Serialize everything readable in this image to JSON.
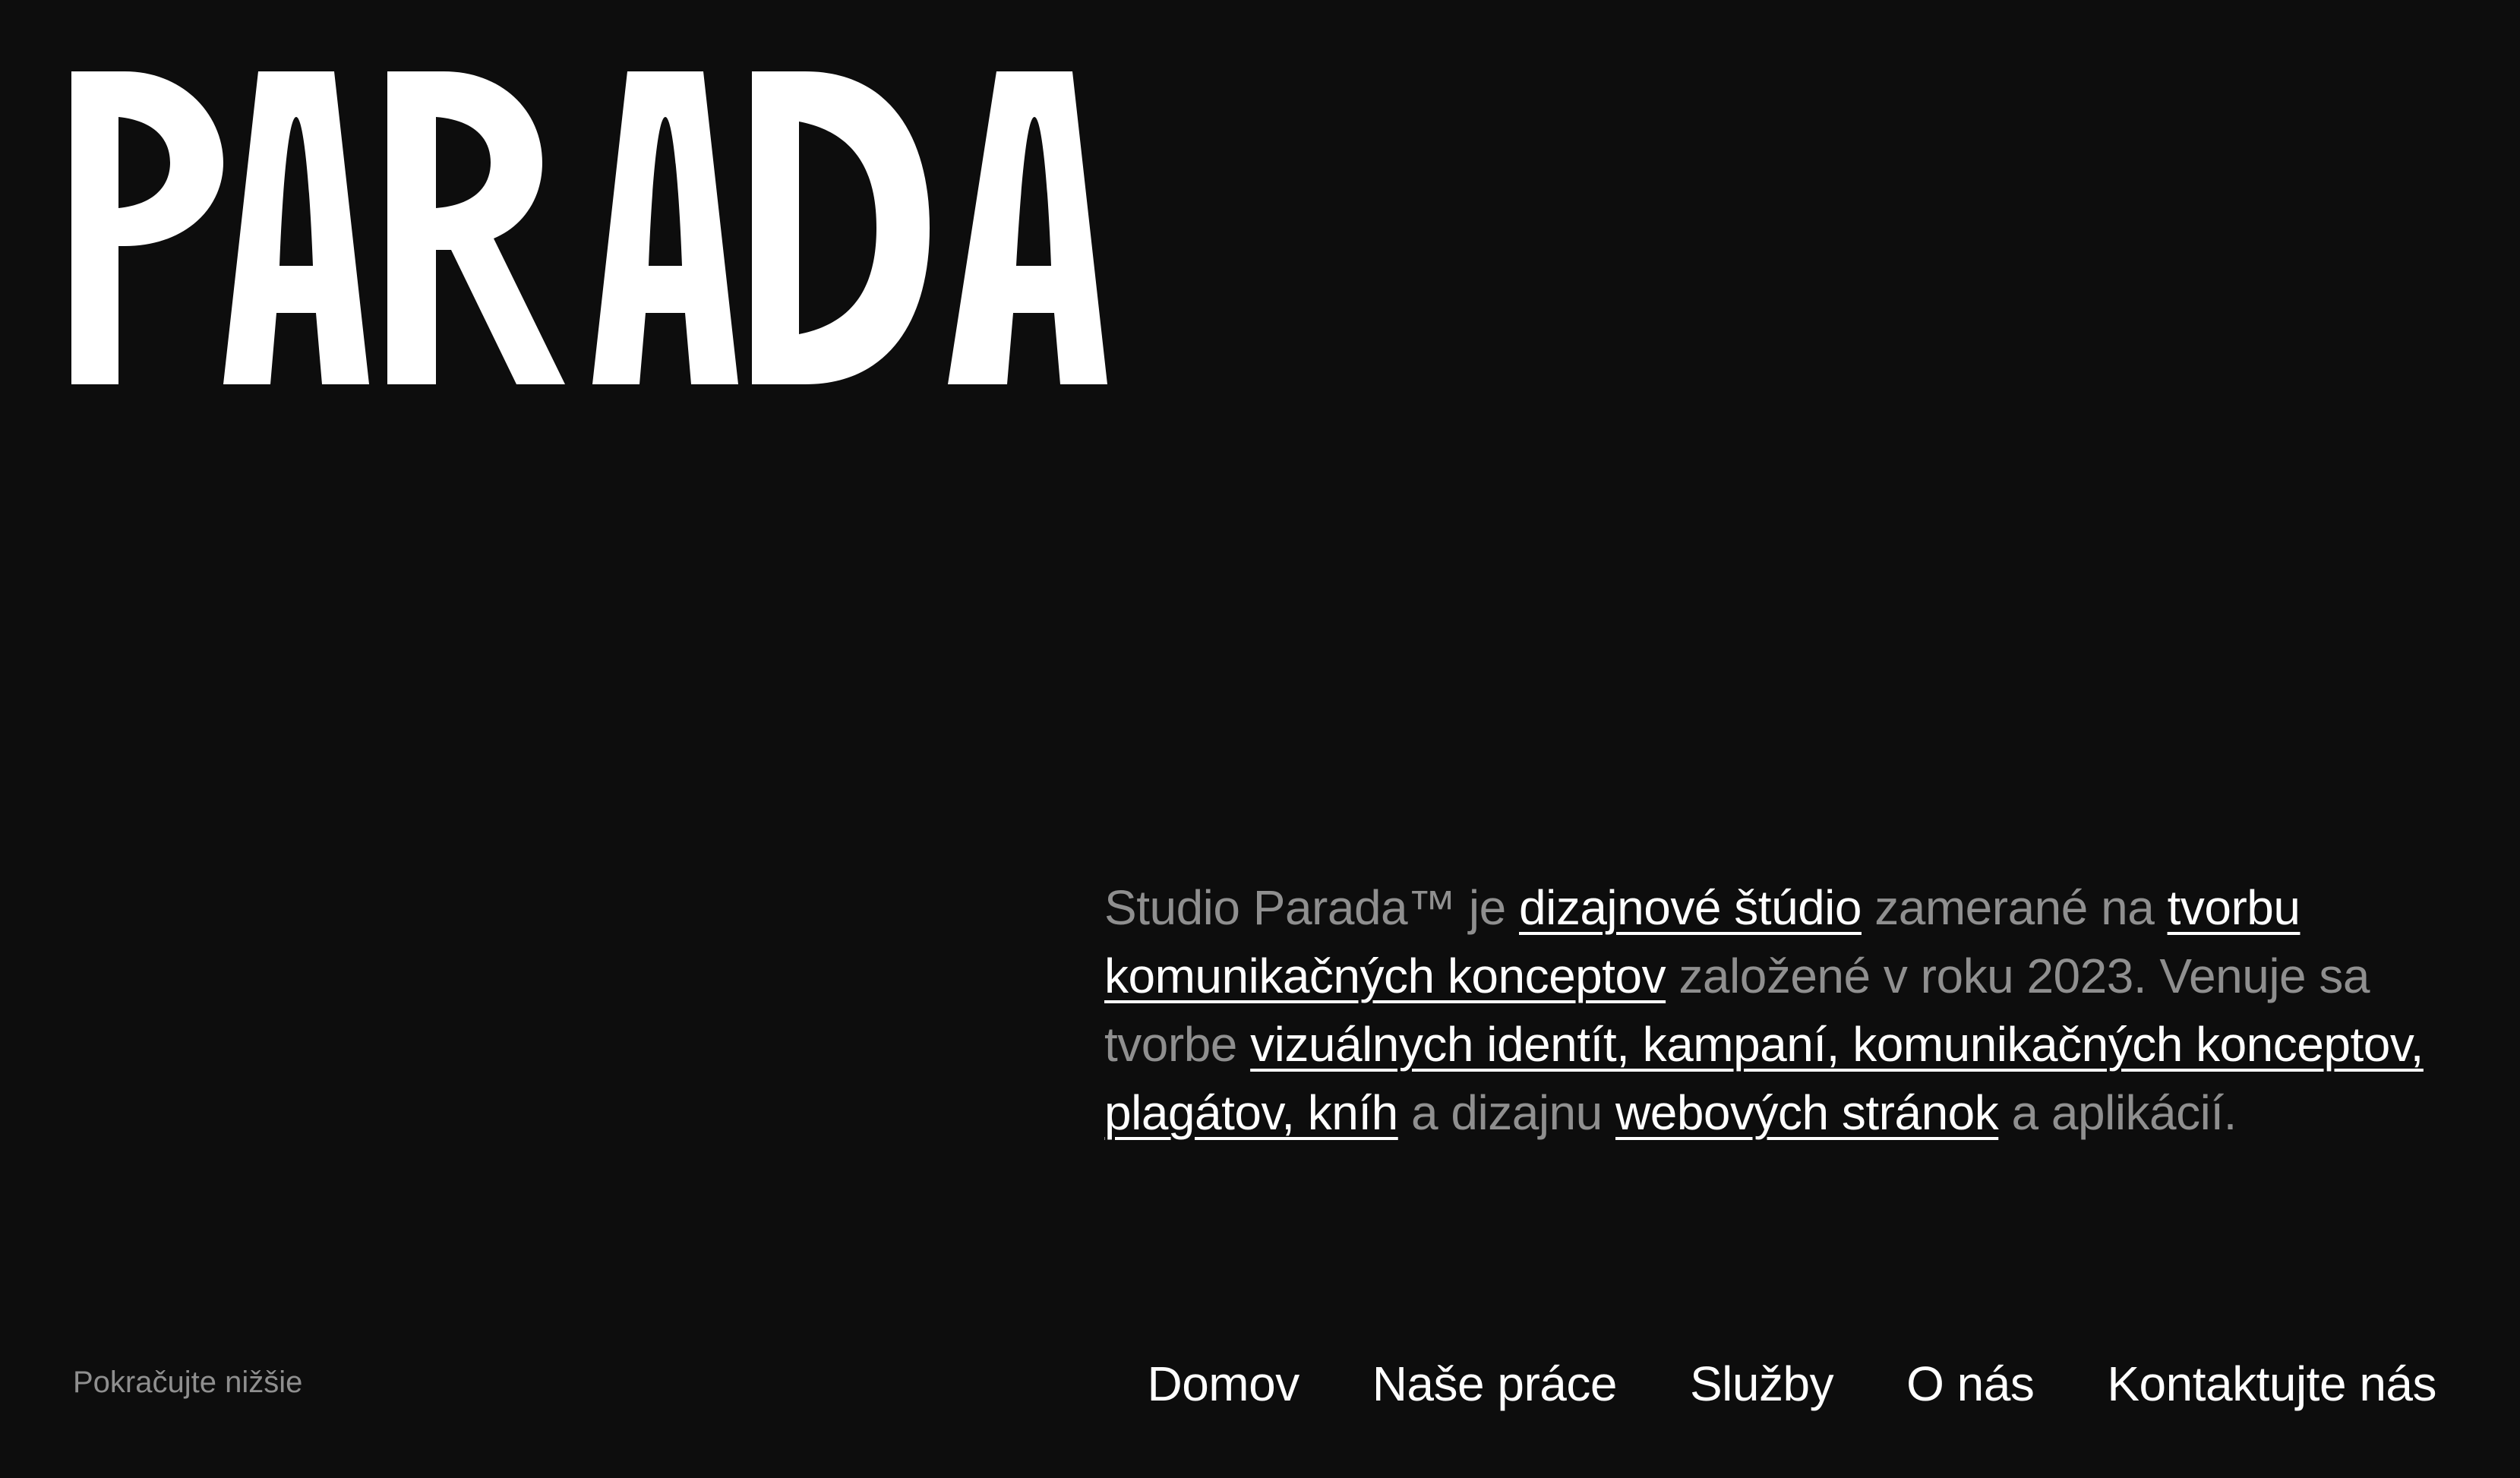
{
  "brand": {
    "logo_text": "PARADA",
    "logo_icon": "parada-wordmark"
  },
  "intro": {
    "t1": "Studio Parada™ je ",
    "l1": "dizajnové štúdio",
    "t2": " zamerané na ",
    "l2": "tvorbu komunikačných konceptov",
    "t3": " založené v roku 2023. Venuje sa tvorbe ",
    "l3": "vizuálnych identít, kampaní, komunikačných konceptov, plagátov, kníh",
    "t4": " a dizajnu ",
    "l4": "webových stránok",
    "t5": " a aplikácií."
  },
  "scroll_hint": "Pokračujte nižšie",
  "nav": {
    "home": "Domov",
    "work": "Naše práce",
    "services": "Služby",
    "about": "O nás",
    "contact": "Kontaktujte nás"
  },
  "colors": {
    "background": "#0d0d0d",
    "text": "#ffffff",
    "muted": "#8f8f8f"
  }
}
